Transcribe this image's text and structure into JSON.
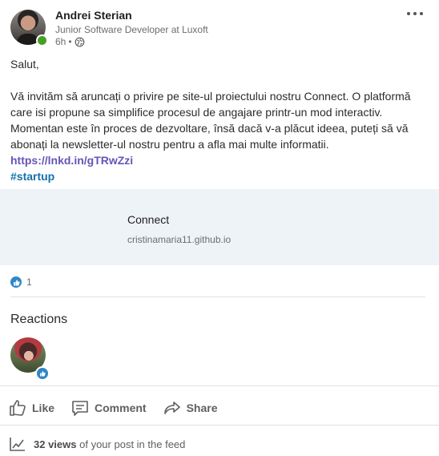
{
  "post": {
    "author": {
      "name": "Andrei Sterian",
      "headline": "Junior Software Developer at Luxoft",
      "time": "6h",
      "visibility_icon": "globe-icon",
      "status_color": "#47a024"
    },
    "greeting": "Salut,",
    "paragraph": "Vă invităm să aruncați o privire pe site-ul proiectului nostru Connect. O platformă care isi propune sa simplifice procesul de angajare printr-un mod interactiv. Momentan este în proces de dezvoltare, însă dacă v-a plăcut ideea, puteți să vă abonați la newsletter-ul nostru pentru a afla mai multe informatii.",
    "link": "https://lnkd.in/gTRwZzi",
    "hashtag": "#startup",
    "preview": {
      "title": "Connect",
      "url": "cristinamaria11.github.io"
    },
    "reactions_count": "1",
    "reactions_heading": "Reactions",
    "actions": {
      "like": "Like",
      "comment": "Comment",
      "share": "Share"
    },
    "views": {
      "count": "32 views",
      "suffix": "of your post in the feed"
    },
    "colors": {
      "link": "#6555b8",
      "hashtag": "#1471a8",
      "like_badge": "#2f87c8",
      "preview_bg": "#eef3f8"
    }
  }
}
